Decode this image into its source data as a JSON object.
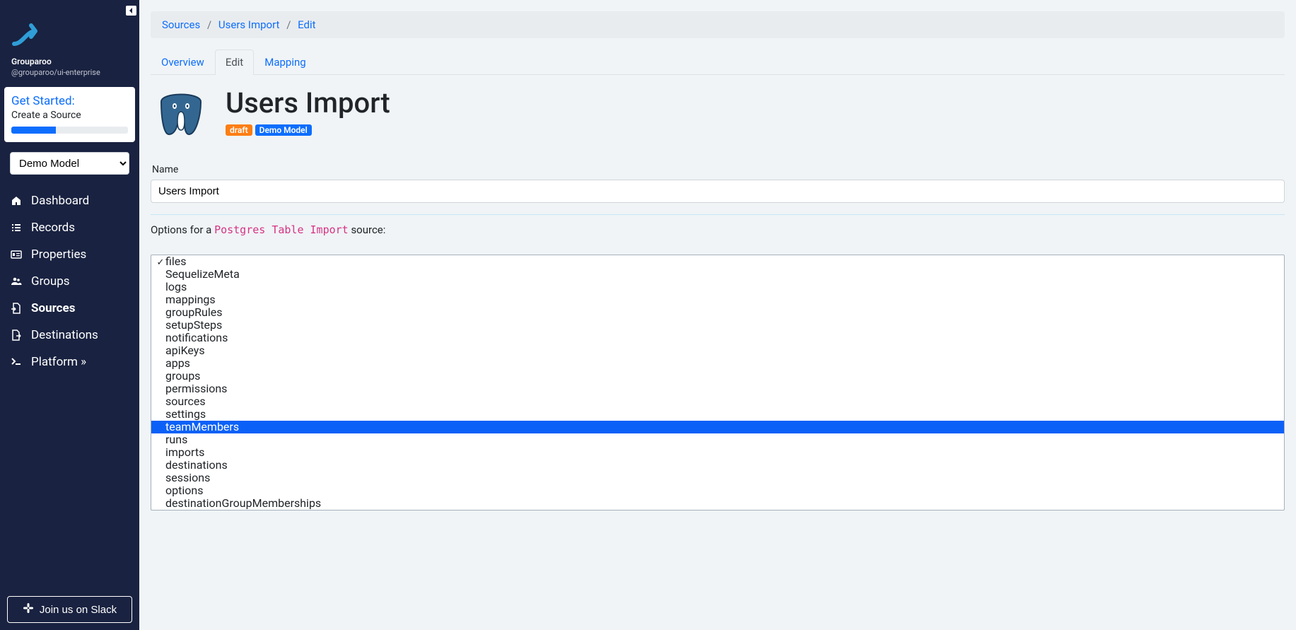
{
  "brand": {
    "name": "Grouparoo",
    "sub": "@grouparoo/ui-enterprise"
  },
  "get_started": {
    "title": "Get Started:",
    "step": "Create a Source"
  },
  "model_selected": "Demo Model",
  "nav": {
    "dashboard": "Dashboard",
    "records": "Records",
    "properties": "Properties",
    "groups": "Groups",
    "sources": "Sources",
    "destinations": "Destinations",
    "platform": "Platform »"
  },
  "slack_btn": "Join us on Slack",
  "breadcrumb": {
    "a": "Sources",
    "b": "Users Import",
    "c": "Edit"
  },
  "tabs": {
    "overview": "Overview",
    "edit": "Edit",
    "mapping": "Mapping"
  },
  "page_title": "Users Import",
  "badges": {
    "draft": "draft",
    "model": "Demo Model"
  },
  "form": {
    "name_label": "Name",
    "name_value": "Users Import",
    "options_prefix": "Options for a ",
    "options_code": "Postgres Table Import",
    "options_suffix": " source:"
  },
  "dropdown": {
    "selected": "files",
    "highlighted_index": 13,
    "items": [
      "files",
      "SequelizeMeta",
      "logs",
      "mappings",
      "groupRules",
      "setupSteps",
      "notifications",
      "apiKeys",
      "apps",
      "groups",
      "permissions",
      "sources",
      "settings",
      "teamMembers",
      "runs",
      "imports",
      "destinations",
      "sessions",
      "options",
      "destinationGroupMemberships"
    ]
  }
}
